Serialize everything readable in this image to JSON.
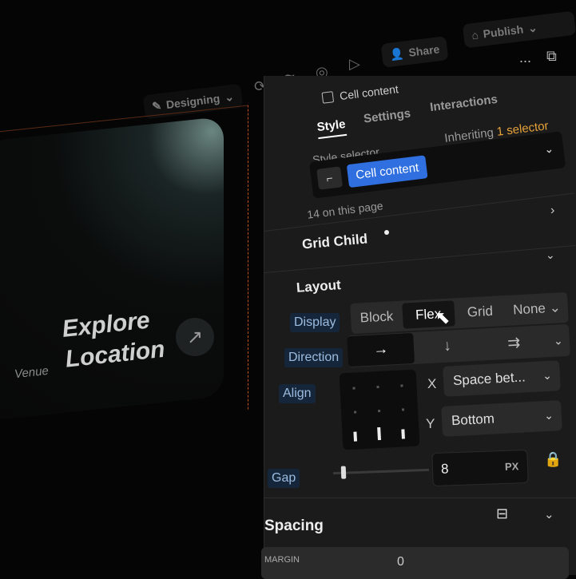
{
  "toolbar": {
    "mode_label": "Designing",
    "share_label": "Share",
    "publish_label": "Publish",
    "more_label": "..."
  },
  "canvas": {
    "title_line1": "Explore",
    "title_line2": "Location",
    "tag": "Venue"
  },
  "panel": {
    "element_name": "Cell content",
    "tabs": [
      "Style",
      "Settings",
      "Interactions"
    ],
    "active_tab": "Style",
    "selector_label": "Style selector",
    "inheriting_label": "Inheriting",
    "inheriting_count": "1 selector",
    "selector_chip": "Cell content",
    "usage_count": "14 on this page",
    "grid_child_title": "Grid Child",
    "layout_title": "Layout",
    "display_label": "Display",
    "display_options": [
      "Block",
      "Flex",
      "Grid",
      "None"
    ],
    "display_selected": "Flex",
    "direction_label": "Direction",
    "direction_options": [
      "→",
      "↓",
      "⇉"
    ],
    "align_label": "Align",
    "align_x_label": "X",
    "align_x_value": "Space bet...",
    "align_y_label": "Y",
    "align_y_value": "Bottom",
    "gap_label": "Gap",
    "gap_value": "8",
    "gap_unit": "PX",
    "spacing_title": "Spacing",
    "margin_label": "MARGIN",
    "margin_value": "0"
  },
  "colors": {
    "accent_blue": "#2f6fe0",
    "selector_orange": "#e8a33a",
    "canvas_outline": "#c0501c"
  }
}
